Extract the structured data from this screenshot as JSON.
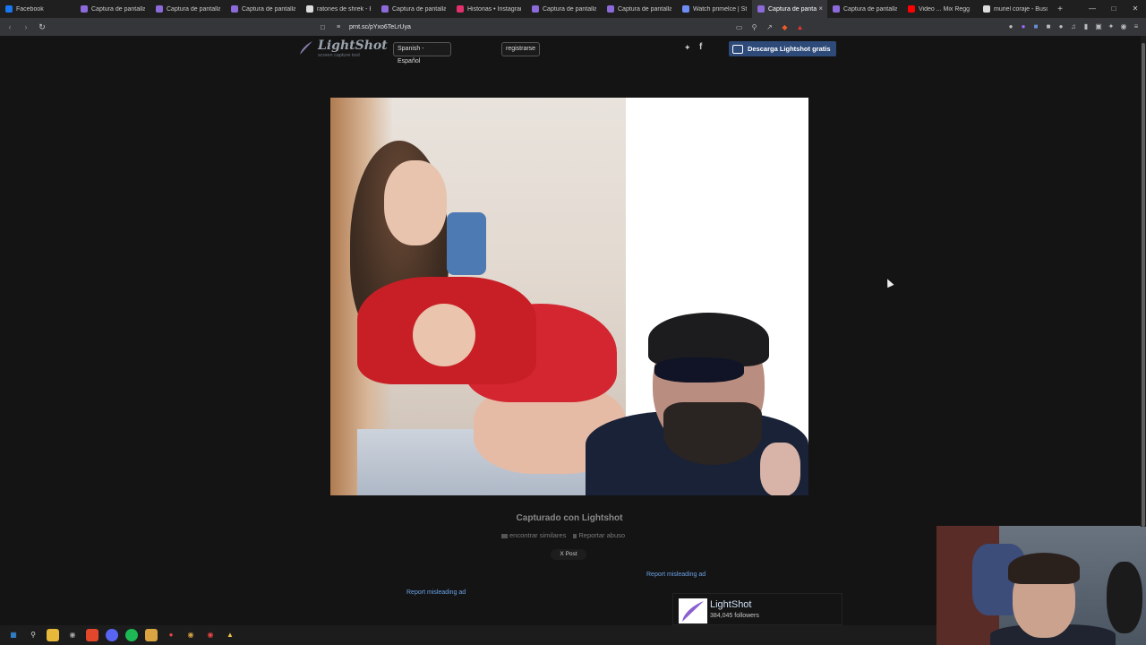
{
  "browser": {
    "tabs": [
      {
        "label": "Facebook",
        "fav_color": "#1877f2"
      },
      {
        "label": "Captura de pantalla p",
        "fav_color": "#8c6ad9"
      },
      {
        "label": "Captura de pantalla p",
        "fav_color": "#8c6ad9"
      },
      {
        "label": "Captura de pantalla p",
        "fav_color": "#8c6ad9"
      },
      {
        "label": "ratones de shrek - Bu",
        "fav_color": "#dddddd"
      },
      {
        "label": "Captura de pantalla p",
        "fav_color": "#8c6ad9"
      },
      {
        "label": "Historias • Instagram",
        "fav_color": "#e1306c"
      },
      {
        "label": "Captura de pantalla p",
        "fav_color": "#8c6ad9"
      },
      {
        "label": "Captura de pantalla p",
        "fav_color": "#8c6ad9"
      },
      {
        "label": "Watch primelce | Stre",
        "fav_color": "#6e8ef5"
      },
      {
        "label": "Captura de panta",
        "fav_color": "#8c6ad9",
        "active": true
      },
      {
        "label": "Captura de pantalla p",
        "fav_color": "#8c6ad9"
      },
      {
        "label": "Video ... Mix Regg",
        "fav_color": "#ff0000"
      },
      {
        "label": "muriel coraje - Buscar",
        "fav_color": "#dddddd"
      }
    ],
    "url": "prnt.sc/pYxo6TeLrUya",
    "new_tab_label": "+",
    "close_tab_label": "×",
    "back_icon": "chevron-left-icon",
    "forward_icon": "chevron-right-icon",
    "reload_icon": "reload-icon"
  },
  "header": {
    "logo_name": "LightShot",
    "logo_tagline": "screen capture tool",
    "language_label": "Spanish - Español",
    "register_label": "registrarse",
    "twitter_icon": "twitter-icon",
    "facebook_icon": "facebook-icon",
    "download_label": "Descarga Lightshot gratis",
    "download_color": "#2e4a79"
  },
  "main": {
    "caption": "Capturado con Lightshot",
    "find_similar_label": "encontrar similares",
    "report_abuse_label": "Reportar abuso",
    "x_post_label": "X Post",
    "report_ad_1": "Report misleading ad",
    "report_ad_2": "Report misleading ad",
    "card_name": "LightShot",
    "card_followers": "384,045 followers",
    "link_color": "#6aa1e6"
  }
}
